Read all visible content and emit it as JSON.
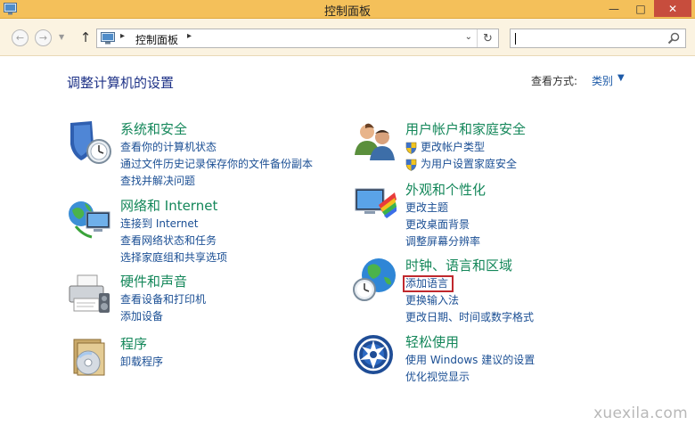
{
  "window": {
    "title": "控制面板",
    "minimize_glyph": "—",
    "maximize_glyph": "□",
    "close_glyph": "✕"
  },
  "toolbar": {
    "back_glyph": "←",
    "forward_glyph": "→",
    "recent_glyph": "▼",
    "up_glyph": "↑",
    "breadcrumb_sep": "▸",
    "breadcrumb": "控制面板",
    "dropdown_glyph": "⌄",
    "refresh_glyph": "↻",
    "search_placeholder": ""
  },
  "header": {
    "title": "调整计算机的设置",
    "view_by_label": "查看方式:",
    "view_by_value": "类别",
    "view_by_arrow": "▼"
  },
  "categories": [
    {
      "title": "系统和安全",
      "icon": "system-security-icon",
      "links": [
        "查看你的计算机状态",
        "通过文件历史记录保存你的文件备份副本",
        "查找并解决问题"
      ]
    },
    {
      "title": "网络和 Internet",
      "icon": "network-icon",
      "links": [
        "连接到 Internet",
        "查看网络状态和任务",
        "选择家庭组和共享选项"
      ]
    },
    {
      "title": "硬件和声音",
      "icon": "printer-icon",
      "links": [
        "查看设备和打印机",
        "添加设备"
      ]
    },
    {
      "title": "程序",
      "icon": "programs-icon",
      "links": [
        "卸载程序"
      ]
    },
    {
      "title": "用户帐户和家庭安全",
      "icon": "users-icon",
      "links": [
        "更改帐户类型",
        "为用户设置家庭安全"
      ]
    },
    {
      "title": "外观和个性化",
      "icon": "appearance-icon",
      "links": [
        "更改主题",
        "更改桌面背景",
        "调整屏幕分辨率"
      ]
    },
    {
      "title": "时钟、语言和区域",
      "icon": "clock-globe-icon",
      "links": [
        "添加语言",
        "更换输入法",
        "更改日期、时间或数字格式"
      ]
    },
    {
      "title": "轻松使用",
      "icon": "ease-of-access-icon",
      "links": [
        "使用 Windows 建议的设置",
        "优化视觉显示"
      ]
    }
  ],
  "watermark": "xuexila.com",
  "colors": {
    "title_bar": "#f4c05a",
    "close_button": "#c74d3d",
    "category_title": "#14875a",
    "link": "#1b4f94",
    "highlight_box": "#c0282d"
  }
}
